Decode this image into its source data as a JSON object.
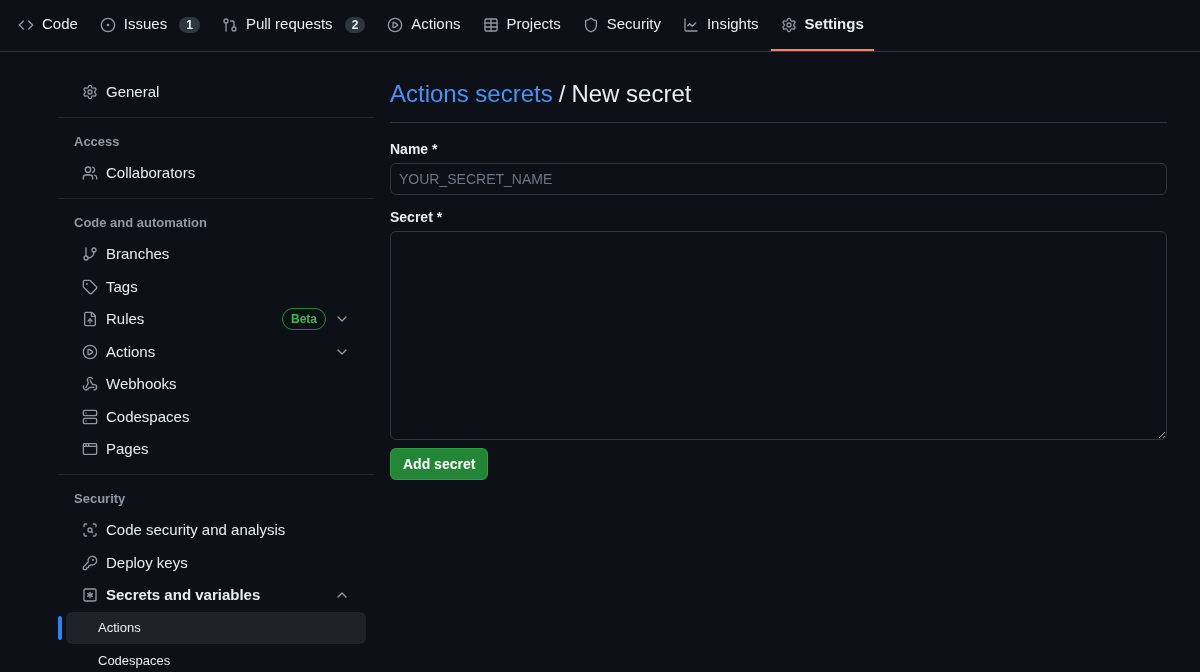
{
  "tabs": [
    {
      "label": "Code",
      "selected": false
    },
    {
      "label": "Issues",
      "count": "1",
      "selected": false
    },
    {
      "label": "Pull requests",
      "count": "2",
      "selected": false
    },
    {
      "label": "Actions",
      "selected": false
    },
    {
      "label": "Projects",
      "selected": false
    },
    {
      "label": "Security",
      "selected": false
    },
    {
      "label": "Insights",
      "selected": false
    },
    {
      "label": "Settings",
      "selected": true
    }
  ],
  "sidebar": {
    "sections": [
      {
        "items": [
          {
            "label": "General",
            "selected": false
          }
        ]
      },
      {
        "heading": "Access",
        "items": [
          {
            "label": "Collaborators",
            "selected": false
          }
        ]
      },
      {
        "heading": "Code and automation",
        "items": [
          {
            "label": "Branches",
            "selected": false
          },
          {
            "label": "Tags",
            "selected": false
          },
          {
            "label": "Rules",
            "badge": "Beta",
            "expanded": false,
            "selected": false
          },
          {
            "label": "Actions",
            "expanded": false,
            "selected": false
          },
          {
            "label": "Webhooks",
            "selected": false
          },
          {
            "label": "Codespaces",
            "selected": false
          },
          {
            "label": "Pages",
            "selected": false
          }
        ]
      },
      {
        "heading": "Security",
        "items": [
          {
            "label": "Code security and analysis",
            "selected": false
          },
          {
            "label": "Deploy keys",
            "selected": false
          },
          {
            "label": "Secrets and variables",
            "expanded": true,
            "selected": false,
            "children": [
              {
                "label": "Actions",
                "selected": true
              },
              {
                "label": "Codespaces",
                "selected": false
              }
            ]
          }
        ]
      }
    ]
  },
  "page": {
    "breadcrumb_link": "Actions secrets",
    "separator": "/",
    "title": "New secret",
    "name_field": {
      "label": "Name *",
      "placeholder": "YOUR_SECRET_NAME"
    },
    "secret_field": {
      "label": "Secret *"
    },
    "submit_button": "Add secret"
  }
}
